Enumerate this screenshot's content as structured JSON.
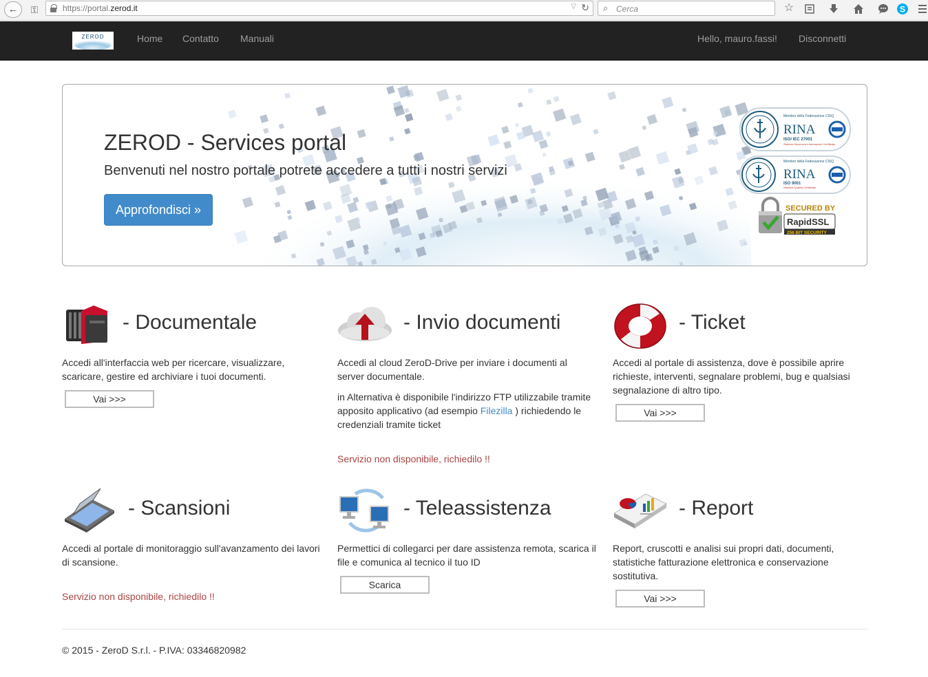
{
  "browser": {
    "url_prefix": "https://portal.",
    "url_domain": "zerod.it",
    "search_placeholder": "Cerca"
  },
  "navbar": {
    "brand": "ZEROD",
    "links": [
      "Home",
      "Contatto",
      "Manuali"
    ],
    "greeting": "Hello, mauro.fassi!",
    "logout": "Disconnetti"
  },
  "jumbotron": {
    "title": "ZEROD - Services portal",
    "lead": "Benvenuti nel nostro portale potrete accedere a tutti i nostri servizi",
    "button": "Approfondisci »",
    "cert_rina_1": {
      "name": "RINA",
      "line1": "Membro della Federazione CISQ",
      "line2": "ISO/ IEC 27001",
      "line3": "Sistema Sicurezza Informazioni Certificato"
    },
    "cert_rina_2": {
      "name": "RINA",
      "line1": "Membro della Federazione CISQ",
      "line2": "ISO 9001",
      "line3": "Sistema Qualità Certificato"
    },
    "ssl": {
      "secured_by": "SECURED BY",
      "brand": "RapidSSL",
      "bits": "256 BIT SECURITY"
    }
  },
  "services": {
    "documentale": {
      "title": "- Documentale",
      "text": "Accedi all'interfaccia web per ricercare, visualizzare, scaricare, gestire ed archiviare i tuoi documenti.",
      "button": "Vai >>>"
    },
    "invio": {
      "title": "- Invio documenti",
      "text": "Accedi al cloud ZeroD-Drive per inviare i documenti al server documentale.",
      "text2_before": "in Alternativa è disponibile l'indirizzo FTP utilizzabile tramite apposito applicativo (ad esempio ",
      "text2_link": "Filezilla",
      "text2_after": " ) richiedendo le credenziali tramite ticket",
      "notice": "Servizio non disponibile, richiedilo !!"
    },
    "ticket": {
      "title": "- Ticket",
      "text": "Accedi al portale di assistenza, dove è possibile aprire richieste, interventi, segnalare problemi, bug e qualsiasi segnalazione di altro tipo.",
      "button": "Vai >>>"
    },
    "scansioni": {
      "title": "- Scansioni",
      "text": "Accedi al portale di monitoraggio sull'avanzamento dei lavori di scansione.",
      "notice": "Servizio non disponibile, richiedilo !!"
    },
    "teleassistenza": {
      "title": "- Teleassistenza",
      "text": "Permettici di collegarci per dare assistenza remota, scarica il file e comunica al tecnico il tuo ID",
      "button": "Scarica"
    },
    "report": {
      "title": "- Report",
      "text": "Report, cruscotti e analisi sui propri dati, documenti, statistiche fatturazione elettronica e conservazione sostitutiva.",
      "button": "Vai >>>"
    }
  },
  "footer": {
    "copyright": "© 2015 - ZeroD S.r.l. - P.IVA: 03346820982"
  },
  "colors": {
    "navbar_bg": "#222222",
    "nav_link": "#9d9d9d",
    "primary": "#428bca",
    "danger_text": "#a94442"
  }
}
